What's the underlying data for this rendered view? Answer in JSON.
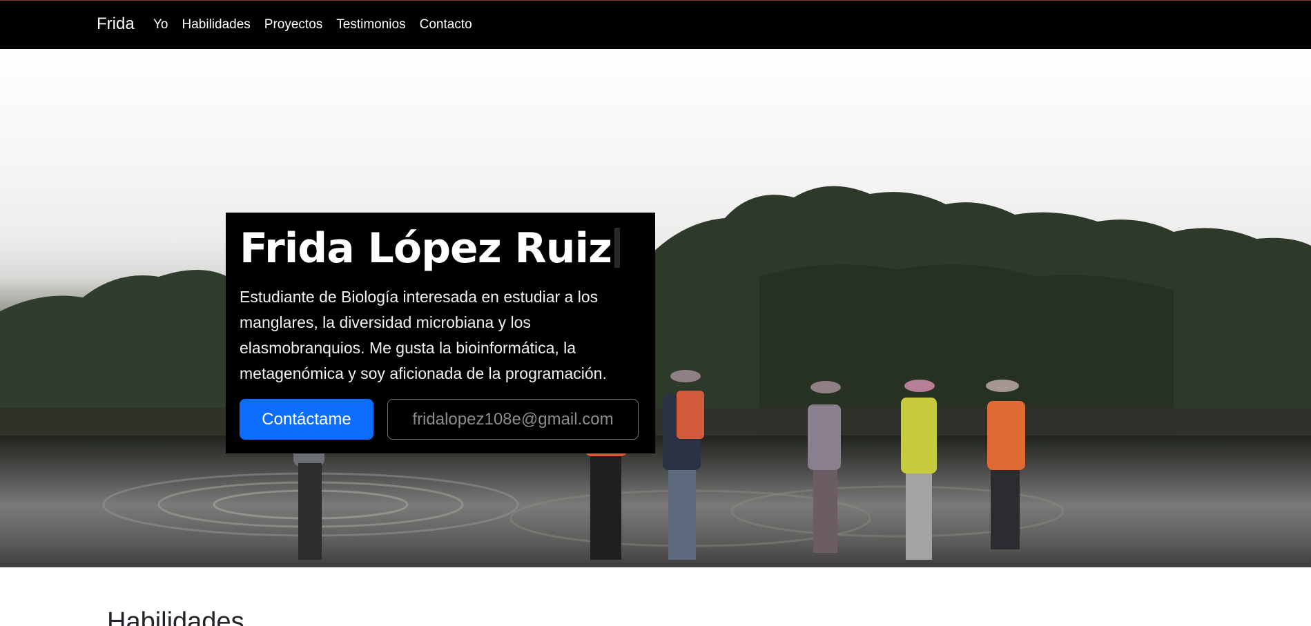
{
  "navbar": {
    "brand": "Frida",
    "links": [
      "Yo",
      "Habilidades",
      "Proyectos",
      "Testimonios",
      "Contacto"
    ]
  },
  "hero": {
    "title": "Frida López Ruiz",
    "description": "Estudiante de Biología interesada en estudiar a los manglares, la diversidad microbiana y los elasmobranquios. Me gusta la bioinformática, la metagenómica y soy aficionada de la programación.",
    "contact_button": "Contáctame",
    "email_button": "fridalopez108e@gmail.com"
  },
  "skills": {
    "heading": "Habilidades"
  },
  "colors": {
    "navbar_bg": "#000000",
    "primary": "#0d6efd",
    "card_bg": "#000000"
  }
}
